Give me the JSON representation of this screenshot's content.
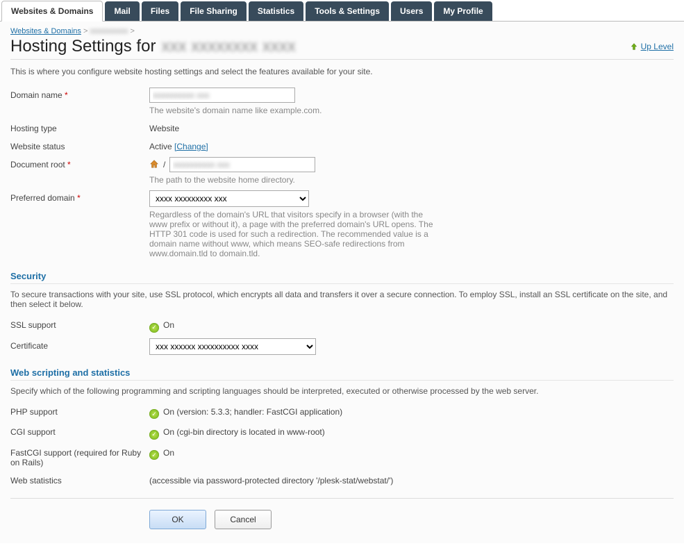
{
  "tabs": [
    "Websites & Domains",
    "Mail",
    "Files",
    "File Sharing",
    "Statistics",
    "Tools & Settings",
    "Users",
    "My Profile"
  ],
  "active_tab": 0,
  "breadcrumb": {
    "root": "Websites & Domains",
    "current_blur": "xxxxxxxxxx",
    "sep": ">"
  },
  "page_title_prefix": "Hosting Settings for",
  "page_title_domain_blur": "xxx xxxxxxxx xxxx",
  "up_level": "Up Level",
  "intro": "This is where you configure website hosting settings and select the features available for your site.",
  "labels": {
    "domain_name": "Domain name",
    "hosting_type": "Hosting type",
    "website_status": "Website status",
    "document_root": "Document root",
    "preferred_domain": "Preferred domain",
    "ssl_support": "SSL support",
    "certificate": "Certificate",
    "php_support": "PHP support",
    "cgi_support": "CGI support",
    "fastcgi_support": "FastCGI support (required for Ruby on Rails)",
    "web_statistics": "Web statistics"
  },
  "fields": {
    "domain_name_value_blur": "xxxxxxxxxx xxx",
    "domain_name_hint": "The website's domain name like example.com.",
    "hosting_type_value": "Website",
    "website_status_value": "Active",
    "website_status_change": "[Change]",
    "document_root_slash": "/",
    "document_root_value_blur": "xxxxxxxxxx xxx",
    "document_root_hint": "The path to the website home directory.",
    "preferred_domain_value_blur": "xxxx xxxxxxxxx xxx",
    "preferred_domain_hint": "Regardless of the domain's URL that visitors specify in a browser (with the www prefix or without it), a page with the preferred domain's URL opens. The HTTP 301 code is used for such a redirection. The recommended value is a domain name without www, which means SEO-safe redirections from www.domain.tld to domain.tld.",
    "ssl_support_value": "On",
    "certificate_value_blur": "xxx xxxxxx xxxxxxxxxx xxxx",
    "php_support_value": "On (version: 5.3.3; handler: FastCGI application)",
    "cgi_support_value": "On (cgi-bin directory is located in www-root)",
    "fastcgi_support_value": "On",
    "web_statistics_value": "(accessible via password-protected directory '/plesk-stat/webstat/')"
  },
  "sections": {
    "security_title": "Security",
    "security_desc": "To secure transactions with your site, use SSL protocol, which encrypts all data and transfers it over a secure connection. To employ SSL, install an SSL certificate on the site, and then select it below.",
    "scripting_title": "Web scripting and statistics",
    "scripting_desc": "Specify which of the following programming and scripting languages should be interpreted, executed or otherwise processed by the web server."
  },
  "buttons": {
    "ok": "OK",
    "cancel": "Cancel"
  }
}
